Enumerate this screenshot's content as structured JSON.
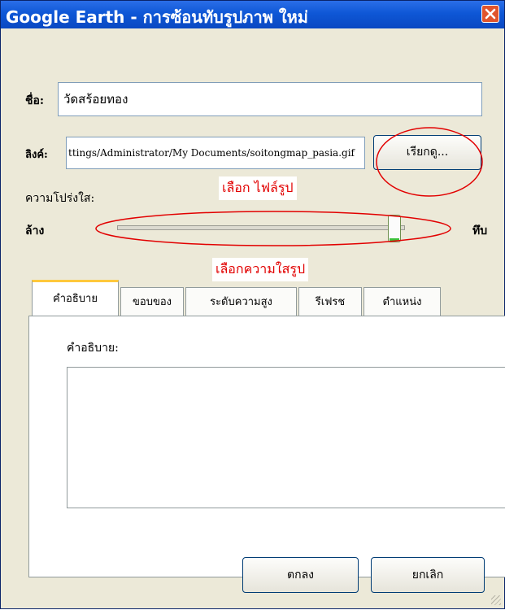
{
  "window": {
    "title": "Google Earth - การซ้อนทับรูปภาพ ใหม่"
  },
  "name": {
    "label": "ชื่อ:",
    "value": "วัดสร้อยทอง"
  },
  "link": {
    "label": "ลิงค์:",
    "value": "ttings/Administrator/My Documents/soitongmap_pasia.gif",
    "browse_label": "เรียกดู..."
  },
  "opacity": {
    "label": "ความโปร่งใส:",
    "left_label": "ล้าง",
    "right_label": "ทึบ",
    "value_percent": 95
  },
  "annotations": {
    "select_file": "เลือก ไฟล์รูป",
    "select_opacity": "เลือกความใสรูป"
  },
  "tabs": [
    {
      "label": "คำอธิบาย",
      "active": true
    },
    {
      "label": "ขอบของ",
      "active": false
    },
    {
      "label": "ระดับความสูง",
      "active": false
    },
    {
      "label": "รีเฟรช",
      "active": false
    },
    {
      "label": "ตำแหน่ง",
      "active": false
    }
  ],
  "description": {
    "label": "คำอธิบาย:",
    "value": ""
  },
  "buttons": {
    "ok": "ตกลง",
    "cancel": "ยกเลิก"
  },
  "colors": {
    "titlebar": "#0a48c2",
    "dialog_bg": "#ece9d8",
    "annotation": "#e20000",
    "highlight_tab": "#ffc83c"
  },
  "icons": {
    "close": "close-icon"
  }
}
